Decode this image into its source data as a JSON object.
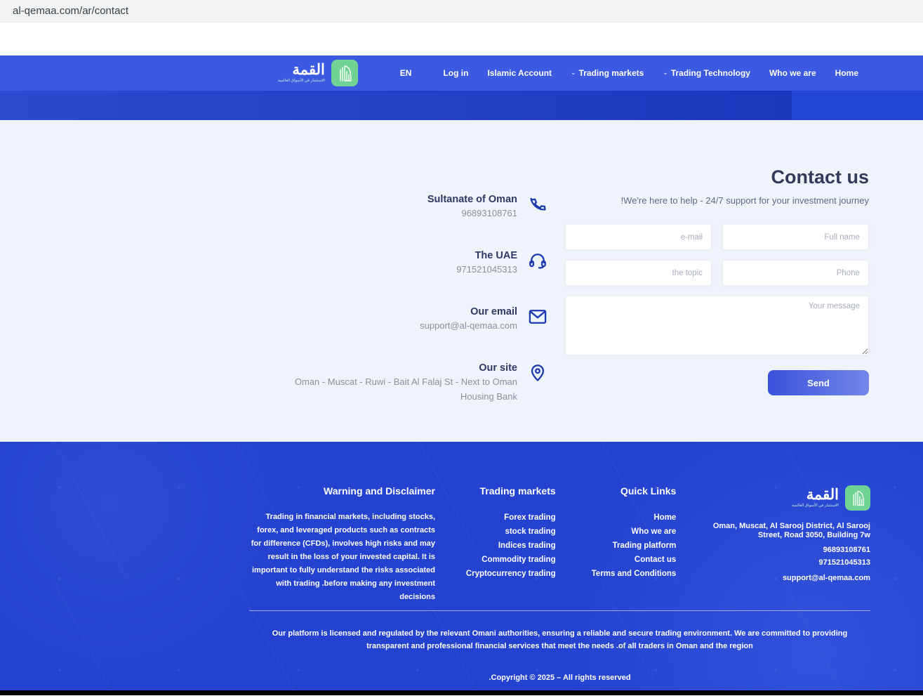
{
  "browser": {
    "url": "al-qemaa.com/ar/contact"
  },
  "navbar": {
    "logo": {
      "title": "القمة",
      "tagline": "الاستثمار في الأسواق العالمية"
    },
    "items": [
      {
        "label": "EN"
      },
      {
        "label": "Log in"
      },
      {
        "label": "Islamic Account"
      },
      {
        "label": "Trading markets",
        "chevron": "⌄"
      },
      {
        "label": "Trading Technology",
        "chevron": "⌄"
      },
      {
        "label": "Who we are"
      },
      {
        "label": "Home"
      }
    ]
  },
  "contact": {
    "title": "Contact us",
    "subtitle": "!We're here to help - 24/7 support for your investment journey",
    "items": [
      {
        "icon": "phone-icon",
        "label": "Sultanate of Oman",
        "value": "96893108761"
      },
      {
        "icon": "headset-icon",
        "label": "The UAE",
        "value": "971521045313"
      },
      {
        "icon": "envelope-icon",
        "label": "Our email",
        "value": "support@al-qemaa.com"
      },
      {
        "icon": "location-pin-icon",
        "label": "Our site",
        "value": "Oman - Muscat - Ruwi - Bait Al Falaj St - Next to Oman Housing Bank"
      }
    ]
  },
  "form": {
    "placeholders": {
      "email": "e-mail",
      "full_name": "Full name",
      "topic": "the topic",
      "phone": "Phone",
      "message": "Your message"
    },
    "send_label": "Send"
  },
  "footer": {
    "disclaimer": {
      "title": "Warning and Disclaimer",
      "body": "Trading in financial markets, including stocks, forex, and leveraged products such as contracts for difference (CFDs), involves high risks and may result in the loss of your invested capital. It is important to fully understand the risks associated with trading .before making any investment decisions"
    },
    "trading_markets": {
      "title": "Trading markets",
      "links": [
        "Forex trading",
        "stock trading",
        "Indices trading",
        "Commodity trading",
        "Cryptocurrency trading"
      ]
    },
    "quick_links": {
      "title": "Quick Links",
      "links": [
        "Home",
        "Who we are",
        "Trading platform",
        "Contact us",
        "Terms and Conditions"
      ]
    },
    "company": {
      "logo_title": "القمة",
      "logo_tagline": "الاستثمار في الأسواق العالمية",
      "address": "Oman, Muscat, Al Sarooj District, Al Sarooj Street, Road 3050, Building 7w",
      "phone_oman": "96893108761",
      "phone_uae": "971521045313",
      "email": "support@al-qemaa.com"
    },
    "license": "Our platform is licensed and regulated by the relevant Omani authorities, ensuring a reliable and secure trading environment. We are committed to providing transparent and professional financial services that meet the needs .of all traders in Oman and the region",
    "copyright": ".Copyright © 2025 – All rights reserved"
  },
  "colors": {
    "navbar_blue": "#3b5ae1",
    "band_dark_blue": "#1c37bc",
    "footer_blue": "#2342cf",
    "brand_green": "#70d293",
    "icon_blue": "#1d3ab0",
    "heading_navy": "#333b5c",
    "send_gradient_start": "#3a52da",
    "send_gradient_end": "#7486e9",
    "page_bg": "#eff3fa"
  }
}
